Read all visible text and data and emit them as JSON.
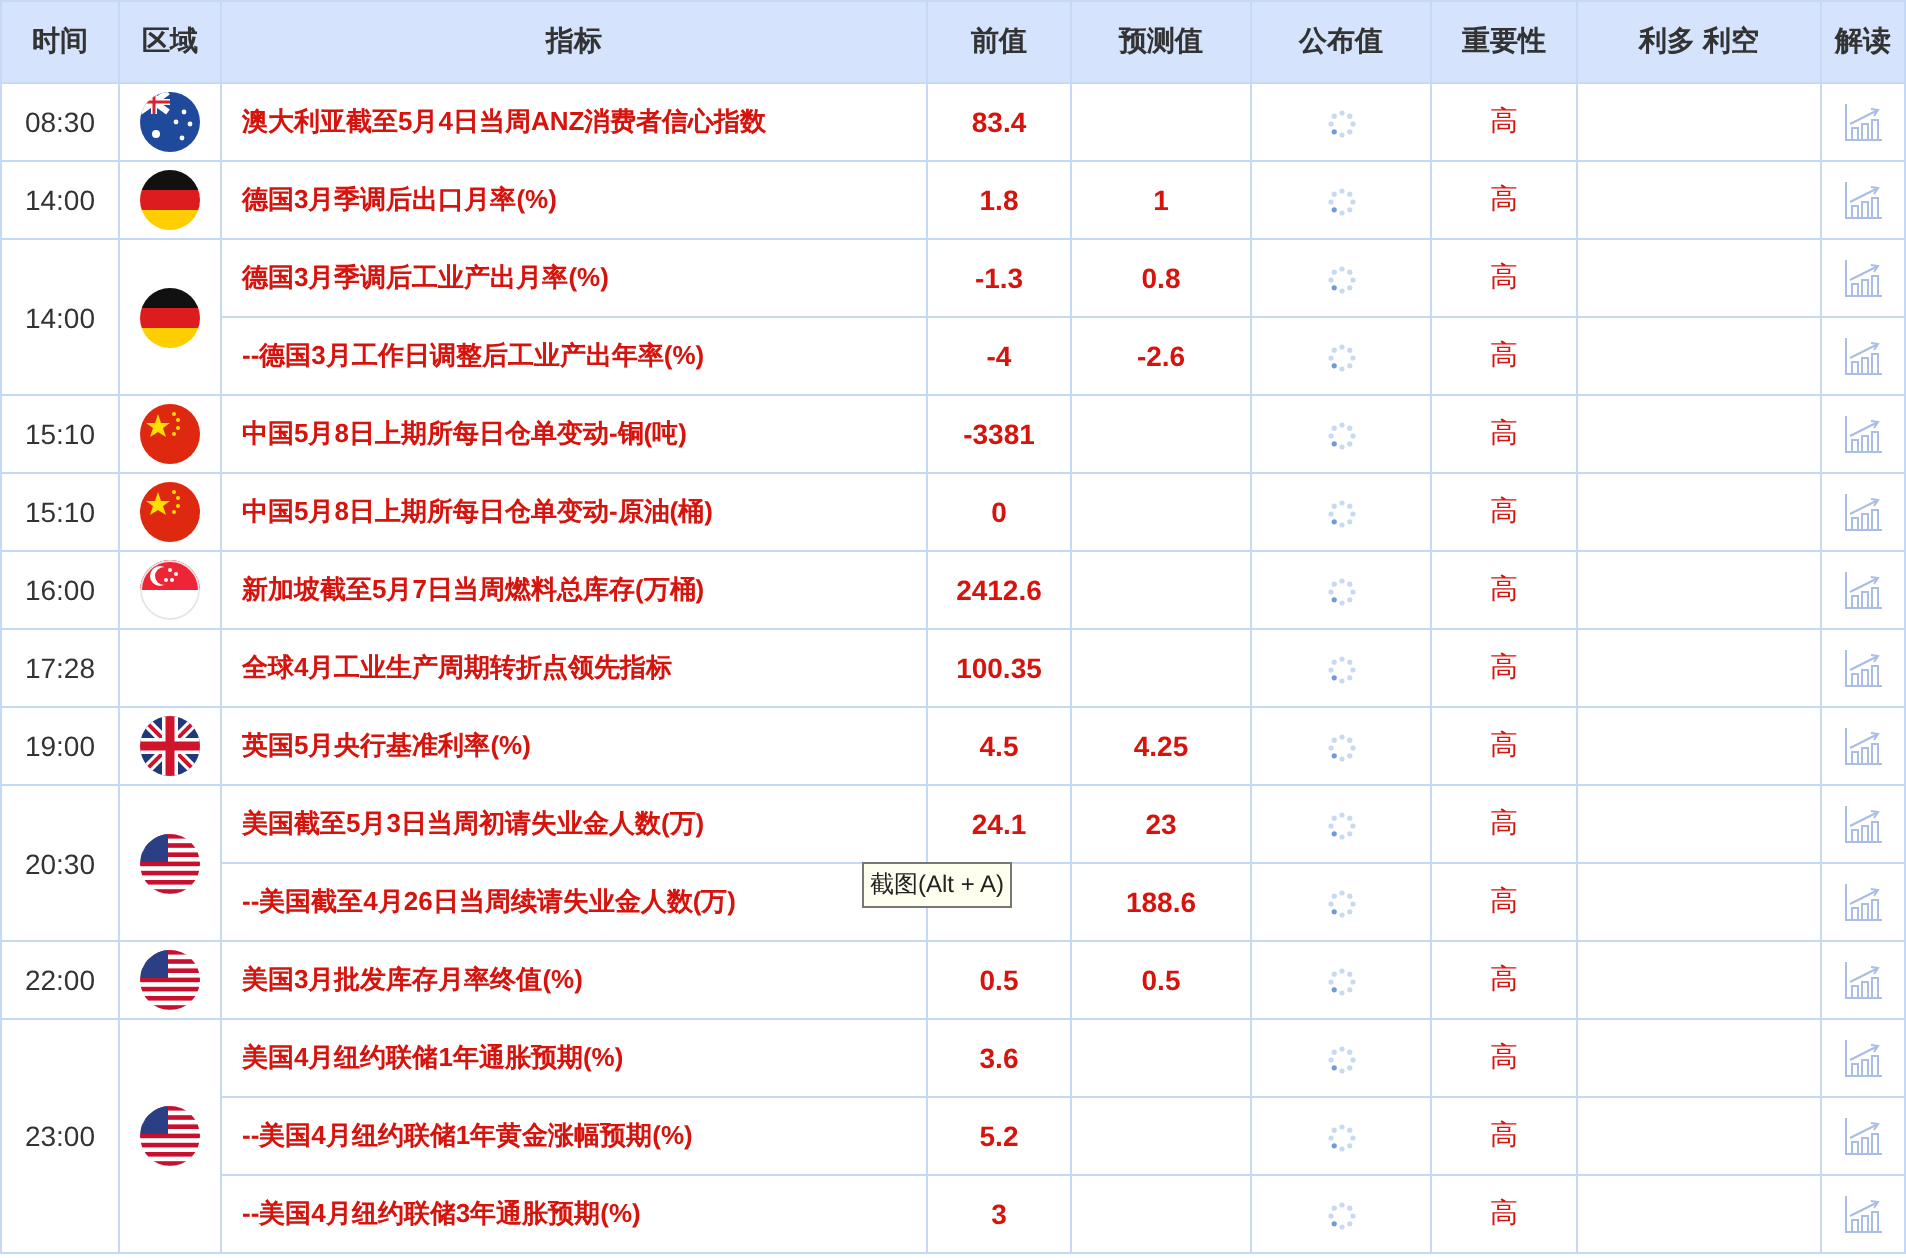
{
  "columns": [
    "时间",
    "区域",
    "指标",
    "前值",
    "预测值",
    "公布值",
    "重要性",
    "利多 利空",
    "解读"
  ],
  "groups": [
    {
      "time": "08:30",
      "kind": "au",
      "items": [
        {
          "indicator": "澳大利亚截至5月4日当周ANZ消费者信心指数",
          "previous": "83.4",
          "importance": "高"
        }
      ]
    },
    {
      "time": "14:00",
      "kind": "de",
      "items": [
        {
          "indicator": "德国3月季调后出口月率(%)",
          "previous": "1.8",
          "forecast": "1",
          "importance": "高"
        }
      ]
    },
    {
      "time": "14:00",
      "kind": "de",
      "items": [
        {
          "indicator": "德国3月季调后工业产出月率(%)",
          "previous": "-1.3",
          "forecast": "0.8",
          "importance": "高"
        },
        {
          "indicator": "--德国3月工作日调整后工业产出年率(%)",
          "previous": "-4",
          "forecast": "-2.6",
          "importance": "高"
        }
      ]
    },
    {
      "time": "15:10",
      "kind": "cn",
      "items": [
        {
          "indicator": "中国5月8日上期所每日仓单变动-铜(吨)",
          "previous": "-3381",
          "importance": "高"
        }
      ]
    },
    {
      "time": "15:10",
      "kind": "cn",
      "items": [
        {
          "indicator": "中国5月8日上期所每日仓单变动-原油(桶)",
          "previous": "0",
          "importance": "高"
        }
      ]
    },
    {
      "time": "16:00",
      "kind": "sg",
      "items": [
        {
          "indicator": "新加坡截至5月7日当周燃料总库存(万桶)",
          "previous": "2412.6",
          "importance": "高"
        }
      ]
    },
    {
      "time": "17:28",
      "items": [
        {
          "indicator": "全球4月工业生产周期转折点领先指标",
          "previous": "100.35",
          "importance": "高"
        }
      ]
    },
    {
      "time": "19:00",
      "kind": "gb",
      "items": [
        {
          "indicator": "英国5月央行基准利率(%)",
          "previous": "4.5",
          "forecast": "4.25",
          "importance": "高"
        }
      ]
    },
    {
      "time": "20:30",
      "kind": "us",
      "items": [
        {
          "indicator": "美国截至5月3日当周初请失业金人数(万)",
          "previous": "24.1",
          "forecast": "23",
          "importance": "高"
        },
        {
          "indicator": "--美国截至4月26日当周续请失业金人数(万)",
          "forecast": "188.6",
          "importance": "高",
          "tooltip": "截图(Alt + A)"
        }
      ]
    },
    {
      "time": "22:00",
      "kind": "us",
      "items": [
        {
          "indicator": "美国3月批发库存月率终值(%)",
          "previous": "0.5",
          "forecast": "0.5",
          "importance": "高"
        }
      ]
    },
    {
      "time": "23:00",
      "kind": "us",
      "items": [
        {
          "indicator": "美国4月纽约联储1年通胀预期(%)",
          "previous": "3.6",
          "importance": "高"
        },
        {
          "indicator": "--美国4月纽约联储1年黄金涨幅预期(%)",
          "previous": "5.2",
          "importance": "高"
        },
        {
          "indicator": "--美国4月纽约联储3年通胀预期(%)",
          "previous": "3",
          "importance": "高"
        }
      ]
    }
  ]
}
